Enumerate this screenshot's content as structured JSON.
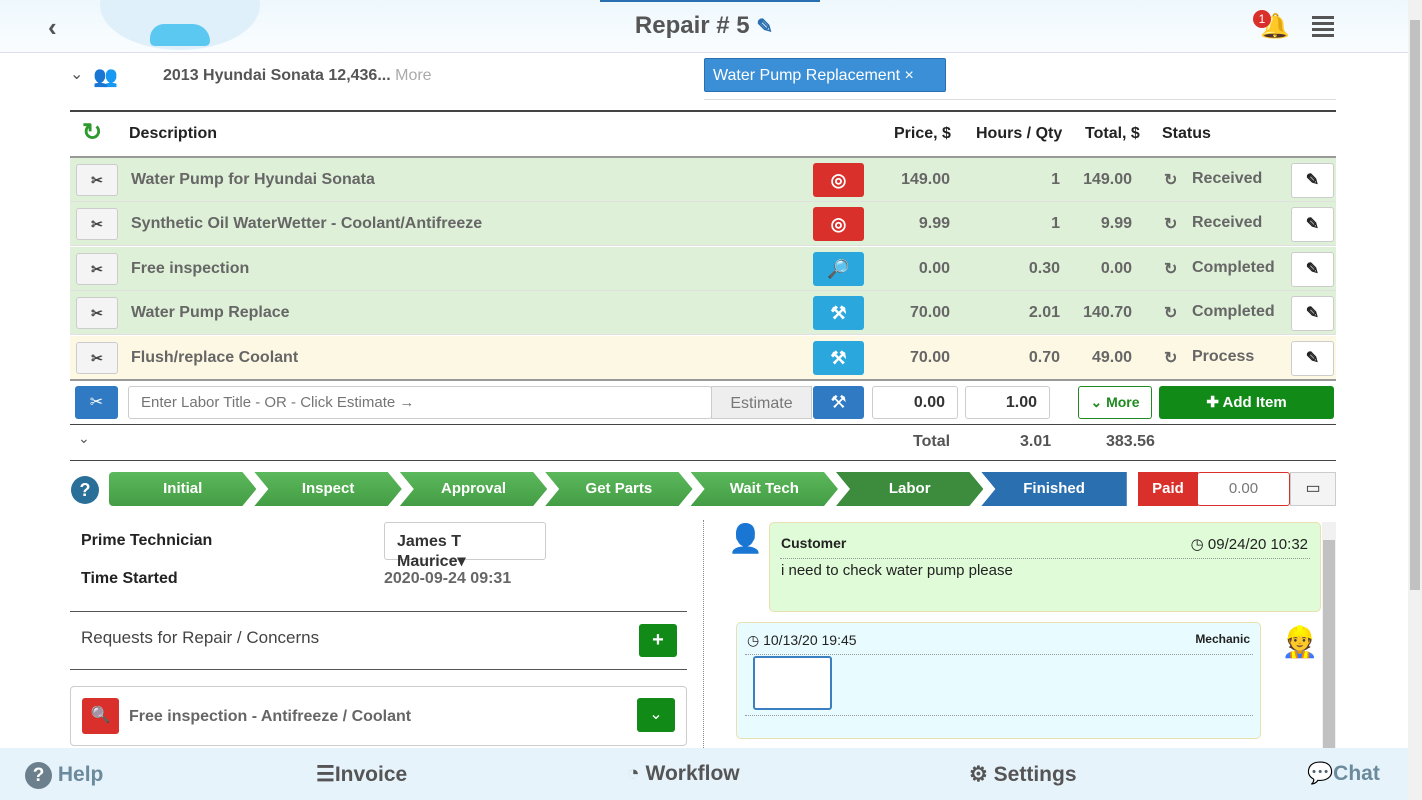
{
  "header": {
    "title": "Repair # 5",
    "notification_count": "1"
  },
  "vehicle": {
    "summary": "2013 Hyundai Sonata 12,436...",
    "more_label": "More",
    "job_tag": "Water Pump Replacement"
  },
  "table": {
    "headers": {
      "description": "Description",
      "price": "Price, $",
      "hours": "Hours / Qty",
      "total": "Total, $",
      "status": "Status"
    },
    "rows": [
      {
        "description": "Water Pump for Hyundai Sonata",
        "type": "part",
        "price": "149.00",
        "hours": "1",
        "total": "149.00",
        "status": "Received"
      },
      {
        "description": "Synthetic Oil WaterWetter - Coolant/Antifreeze",
        "type": "part",
        "price": "9.99",
        "hours": "1",
        "total": "9.99",
        "status": "Received"
      },
      {
        "description": "Free inspection",
        "type": "inspection",
        "price": "0.00",
        "hours": "0.30",
        "total": "0.00",
        "status": "Completed"
      },
      {
        "description": "Water Pump Replace",
        "type": "labor",
        "price": "70.00",
        "hours": "2.01",
        "total": "140.70",
        "status": "Completed"
      },
      {
        "description": "Flush/replace Coolant",
        "type": "labor",
        "price": "70.00",
        "hours": "0.70",
        "total": "49.00",
        "status": "Process"
      }
    ],
    "new_item": {
      "placeholder": "Enter Labor Title - OR - Click Estimate →",
      "estimate_label": "Estimate",
      "price": "0.00",
      "qty": "1.00",
      "more_label": "More",
      "add_label": "Add Item"
    },
    "totals": {
      "label": "Total",
      "hours": "3.01",
      "total": "383.56"
    }
  },
  "workflow": {
    "stages": [
      "Initial",
      "Inspect",
      "Approval",
      "Get Parts",
      "Wait Tech",
      "Labor",
      "Finished"
    ],
    "paid_label": "Paid",
    "paid_value": "0.00"
  },
  "details": {
    "prime_tech_label": "Prime Technician",
    "prime_tech": "James T Maurice",
    "time_started_label": "Time Started",
    "time_started": "2020-09-24 09:31",
    "requests_label": "Requests for Repair / Concerns",
    "concern": "Free inspection - Antifreeze / Coolant"
  },
  "chat": {
    "messages": [
      {
        "author": "Customer",
        "time": "09/24/20 10:32",
        "text": "i need to check water pump please"
      },
      {
        "author": "Mechanic",
        "time": "10/13/20 19:45",
        "text": ""
      }
    ]
  },
  "footer": {
    "help": "Help",
    "invoice": "Invoice",
    "workflow": "Workflow",
    "settings": "Settings",
    "chat": "Chat"
  },
  "colors": {
    "part": "#d9302c",
    "labor": "#2aa7dc",
    "green": "#5cb85c",
    "dark_green": "#3d8b3d",
    "finished": "#2a6fb0",
    "row_done": "#dff0d8",
    "row_process": "#fcf8e3"
  }
}
